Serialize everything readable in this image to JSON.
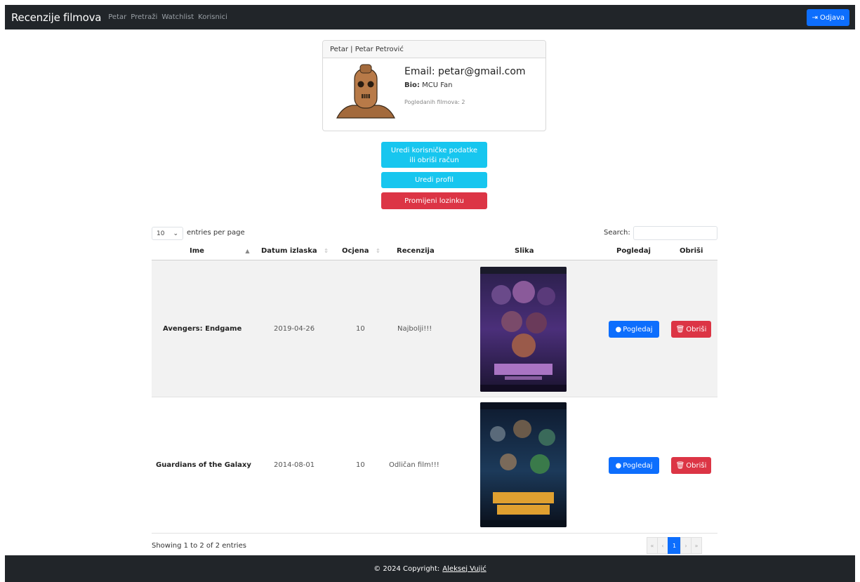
{
  "navbar": {
    "brand": "Recenzije filmova",
    "links": [
      "Petar",
      "Pretraži",
      "Watchlist",
      "Korisnici"
    ],
    "logout_label": "Odjava"
  },
  "profile": {
    "header": "Petar | Petar Petrović",
    "email": "Email: petar@gmail.com",
    "bio_label": "Bio:",
    "bio_value": "MCU Fan",
    "watched": "Pogledanih filmova: 2"
  },
  "actions": {
    "edit_user_line1": "Uredi korisničke podatke",
    "edit_user_line2": "ili obriši račun",
    "edit_profile": "Uredi profil",
    "change_password": "Promijeni lozinku"
  },
  "table_controls": {
    "page_length": "10",
    "length_label": "entries per page",
    "search_label": "Search:",
    "search_value": ""
  },
  "table": {
    "columns": [
      "Ime",
      "Datum izlaska",
      "Ocjena",
      "Recenzija",
      "Slika",
      "Pogledaj",
      "Obriši"
    ],
    "rows": [
      {
        "name": "Avengers: Endgame",
        "date": "2019-04-26",
        "rating": "10",
        "review": "Najbolji!!!",
        "poster": "avengers-endgame-poster",
        "view": "Pogledaj",
        "delete": "Obriši"
      },
      {
        "name": "Guardians of the Galaxy",
        "date": "2014-08-01",
        "rating": "10",
        "review": "Odličan film!!!",
        "poster": "guardians-of-the-galaxy-poster",
        "view": "Pogledaj",
        "delete": "Obriši"
      }
    ]
  },
  "table_info": "Showing 1 to 2 of 2 entries",
  "pagination": {
    "first": "«",
    "prev": "‹",
    "current": "1",
    "next": "›",
    "last": "»"
  },
  "footer": {
    "text": "© 2024 Copyright:",
    "author": "Aleksej Vujić"
  },
  "colors": {
    "navbar": "#212529",
    "primary": "#0d6efd",
    "info": "#17c6ef",
    "danger": "#dc3545"
  }
}
